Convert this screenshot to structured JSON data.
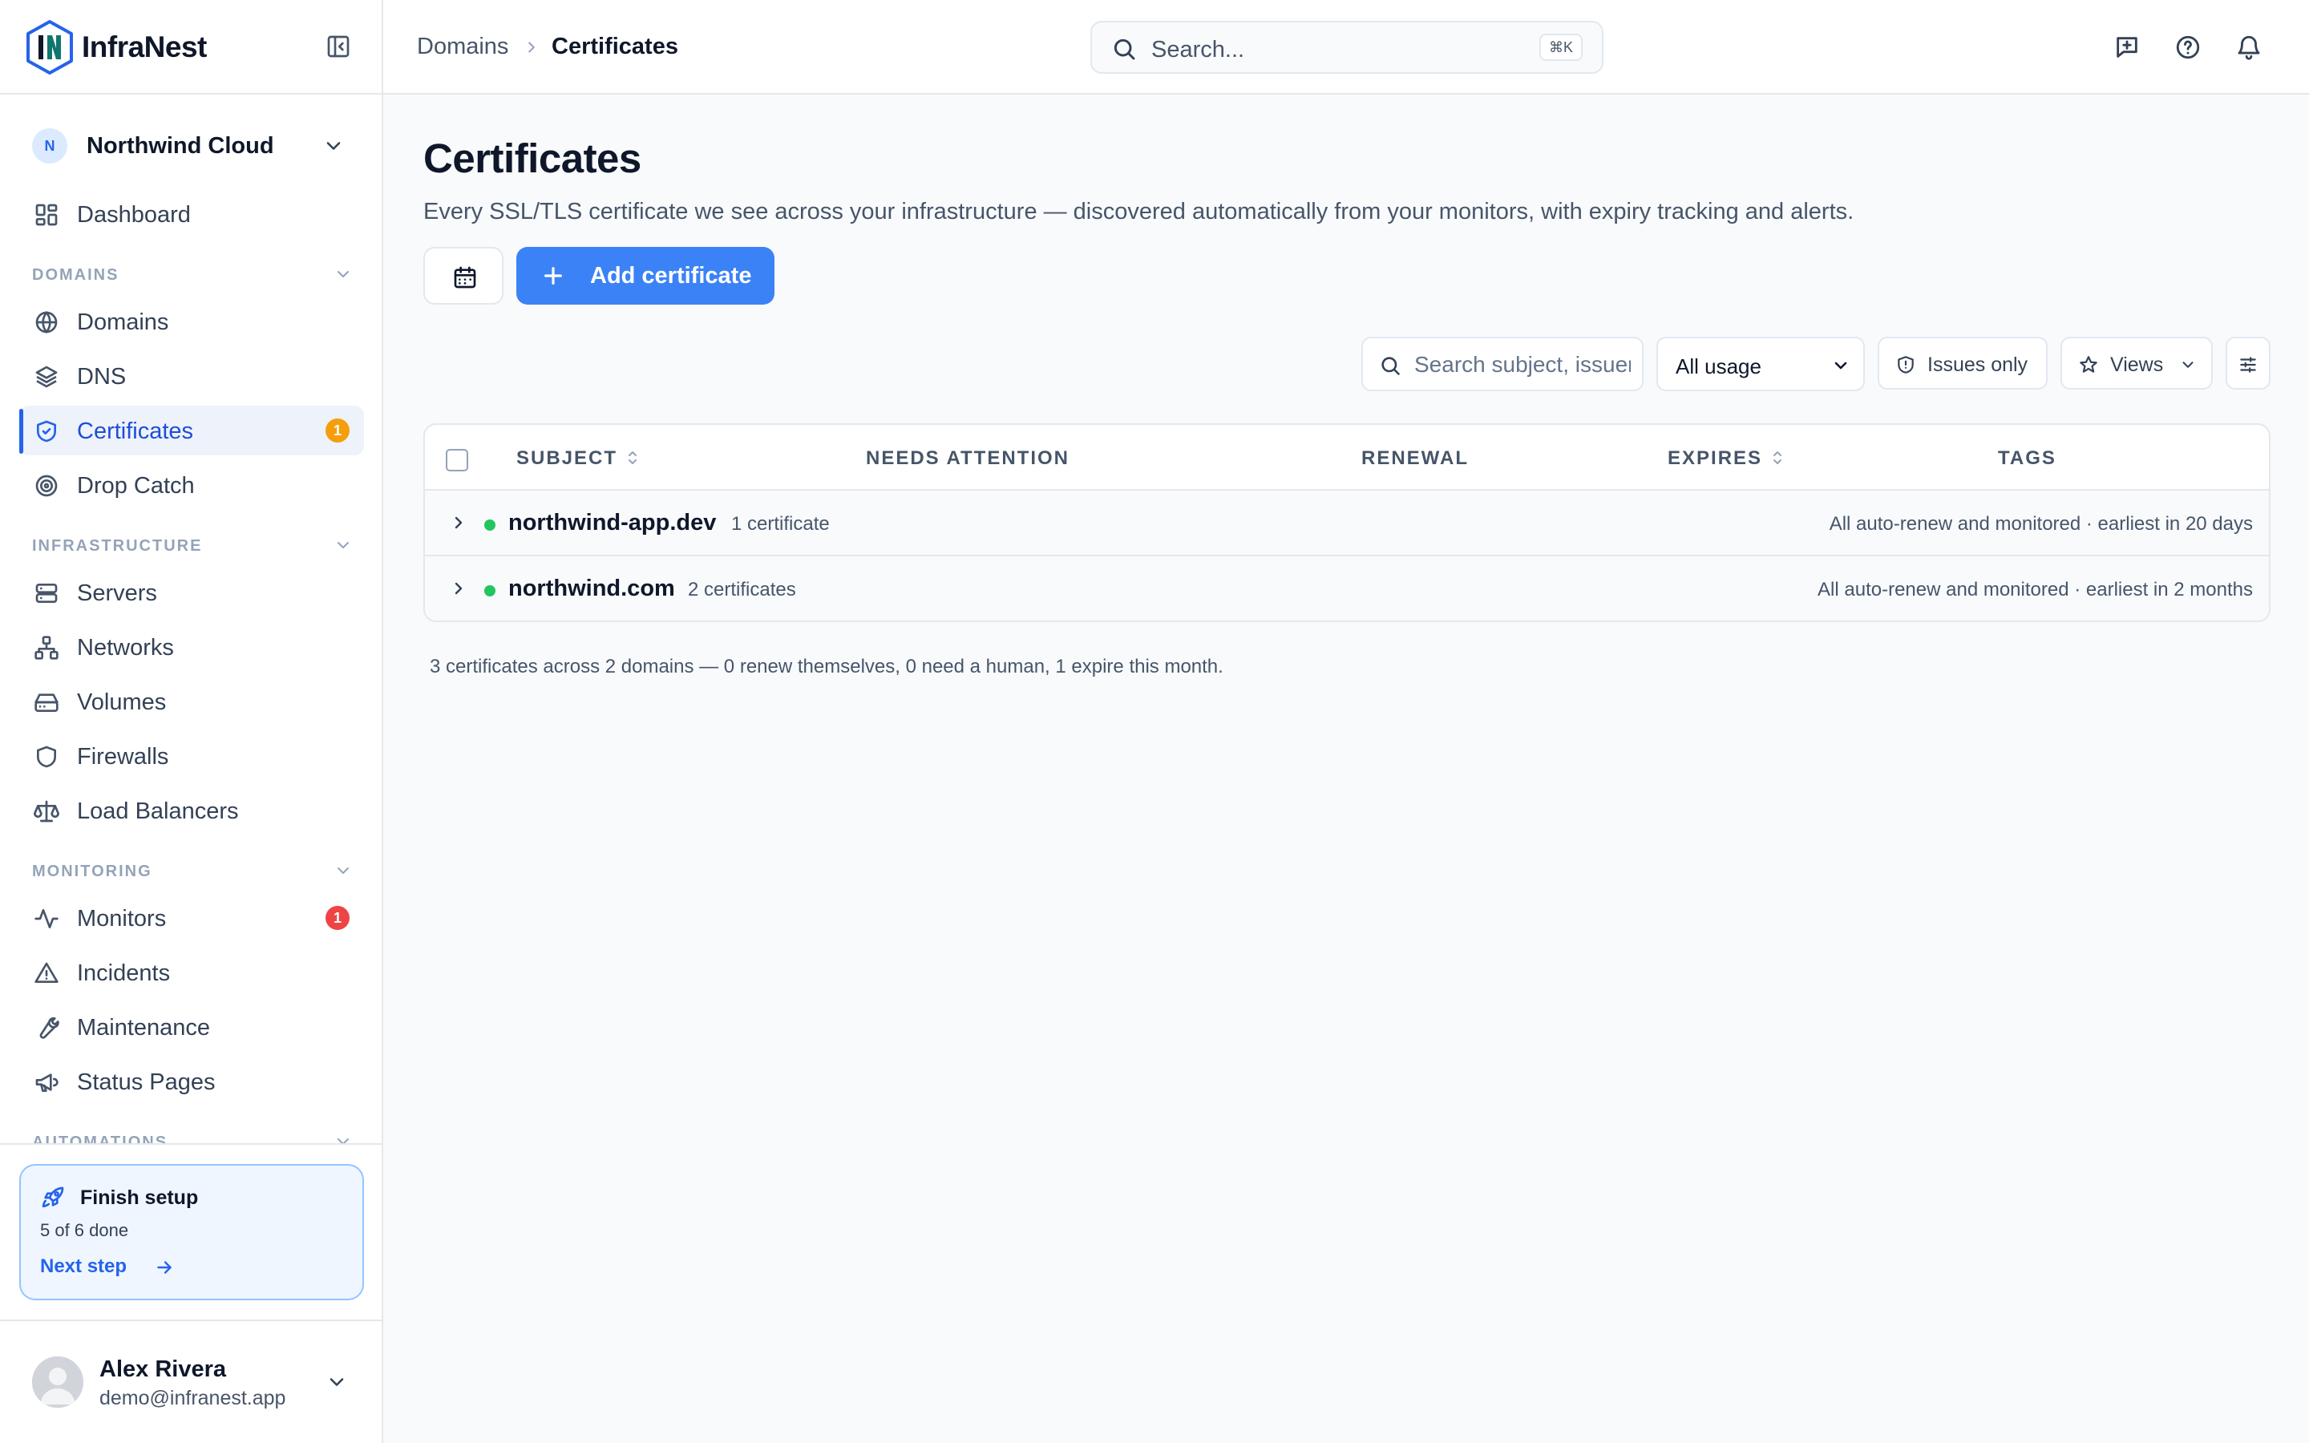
{
  "brand": {
    "name": "InfraNest"
  },
  "workspace": {
    "initial": "N",
    "name": "Northwind Cloud"
  },
  "sidebar": {
    "dashboard": "Dashboard",
    "sections": {
      "domains": "DOMAINS",
      "infrastructure": "INFRASTRUCTURE",
      "monitoring": "MONITORING",
      "automations": "AUTOMATIONS"
    },
    "items": {
      "domains": "Domains",
      "dns": "DNS",
      "certificates": "Certificates",
      "certificates_badge": "1",
      "drop_catch": "Drop Catch",
      "servers": "Servers",
      "networks": "Networks",
      "volumes": "Volumes",
      "firewalls": "Firewalls",
      "load_balancers": "Load Balancers",
      "monitors": "Monitors",
      "monitors_badge": "1",
      "incidents": "Incidents",
      "maintenance": "Maintenance",
      "status_pages": "Status Pages"
    },
    "setup": {
      "title": "Finish setup",
      "progress": "5 of 6 done",
      "link": "Next step"
    },
    "user": {
      "name": "Alex Rivera",
      "email": "demo@infranest.app"
    }
  },
  "topbar": {
    "breadcrumb": [
      "Domains",
      "Certificates"
    ],
    "search_placeholder": "Search...",
    "search_shortcut": "⌘K"
  },
  "page": {
    "title": "Certificates",
    "description": "Every SSL/TLS certificate we see across your infrastructure — discovered automatically from your monitors, with expiry tracking and alerts.",
    "add_button": "Add certificate"
  },
  "filters": {
    "search_placeholder": "Search subject, issuer…",
    "usage_selected": "All usage",
    "issues_only": "Issues only",
    "views": "Views"
  },
  "table": {
    "columns": [
      "SUBJECT",
      "NEEDS ATTENTION",
      "RENEWAL",
      "EXPIRES",
      "TAGS"
    ],
    "rows": [
      {
        "domain": "northwind-app.dev",
        "count": "1 certificate",
        "summary": "All auto-renew and monitored · earliest in 20 days"
      },
      {
        "domain": "northwind.com",
        "count": "2 certificates",
        "summary": "All auto-renew and monitored · earliest in 2 months"
      }
    ]
  },
  "footer_note": "3 certificates across 2 domains — 0 renew themselves, 0 need a human, 1 expire this month.",
  "colors": {
    "accent": "#3b82f6",
    "active_text": "#1d4ed8",
    "status_ok": "#22c55e",
    "badge_warning": "#f59e0b",
    "badge_alert": "#ef4444"
  }
}
